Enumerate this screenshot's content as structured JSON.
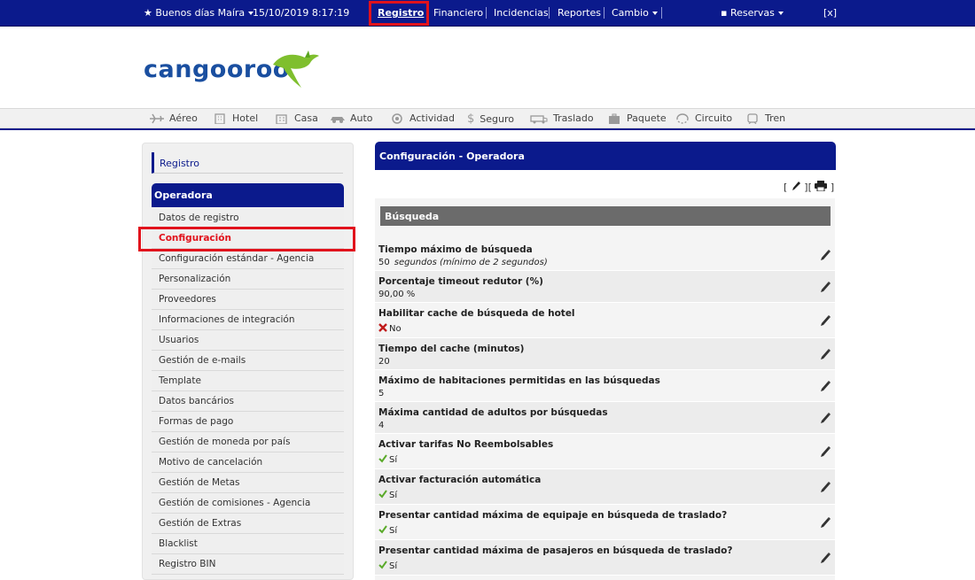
{
  "topbar": {
    "greeting": "Buenos días Maíra",
    "datetime": "15/10/2019 8:17:19",
    "menu": [
      "Registro",
      "Financiero",
      "Incidencias",
      "Reportes",
      "Cambio"
    ],
    "reservas": "Reservas",
    "close": "[x]"
  },
  "brand": {
    "name": "cangooroo"
  },
  "products": [
    "Aéreo",
    "Hotel",
    "Casa",
    "Auto",
    "Actividad",
    "Seguro",
    "Traslado",
    "Paquete",
    "Circuito",
    "Tren"
  ],
  "sidebar": {
    "registro": "Registro",
    "heading": "Operadora",
    "items": [
      "Datos de registro",
      "Configuración",
      "Configuración estándar - Agencia",
      "Personalización",
      "Proveedores",
      "Informaciones de integración",
      "Usuarios",
      "Gestión de e-mails",
      "Template",
      "Datos bancários",
      "Formas de pago",
      "Gestión de moneda por país",
      "Motivo de cancelación",
      "Gestión de Metas",
      "Gestión de comisiones - Agencia",
      "Gestión de Extras",
      "Blacklist",
      "Registro BIN"
    ]
  },
  "main": {
    "title": "Configuración - Operadora",
    "tools": {
      "open": "[",
      "mid": "][",
      "close": "]"
    },
    "section": "Búsqueda",
    "fields": [
      {
        "label": "Tiempo máximo de búsqueda",
        "value": "50",
        "note": "segundos (mínimo de 2 segundos)"
      },
      {
        "label": "Porcentaje timeout redutor (%)",
        "value": "90,00 %"
      },
      {
        "label": "Habilitar cache de búsqueda de hotel",
        "value": "No",
        "icon": "cross-icon"
      },
      {
        "label": "Tiempo del cache (minutos)",
        "value": "20"
      },
      {
        "label": "Máximo de habitaciones permitidas en las búsquedas",
        "value": "5"
      },
      {
        "label": "Máxima cantidad de adultos por búsquedas",
        "value": "4"
      },
      {
        "label": "Activar tarifas No Reembolsables",
        "value": "Sí",
        "icon": "check-icon"
      },
      {
        "label": "Activar facturación automática",
        "value": "Sí",
        "icon": "check-icon"
      },
      {
        "label": "Presentar cantidad máxima de equipaje en búsqueda de traslado?",
        "value": "Sí",
        "icon": "check-icon"
      },
      {
        "label": "Presentar cantidad máxima de pasajeros en búsqueda de traslado?",
        "value": "Sí",
        "icon": "check-icon"
      }
    ]
  },
  "colors": {
    "primary": "#0b1a8c",
    "highlight": "#e1121c",
    "section": "#6b6b6b"
  }
}
